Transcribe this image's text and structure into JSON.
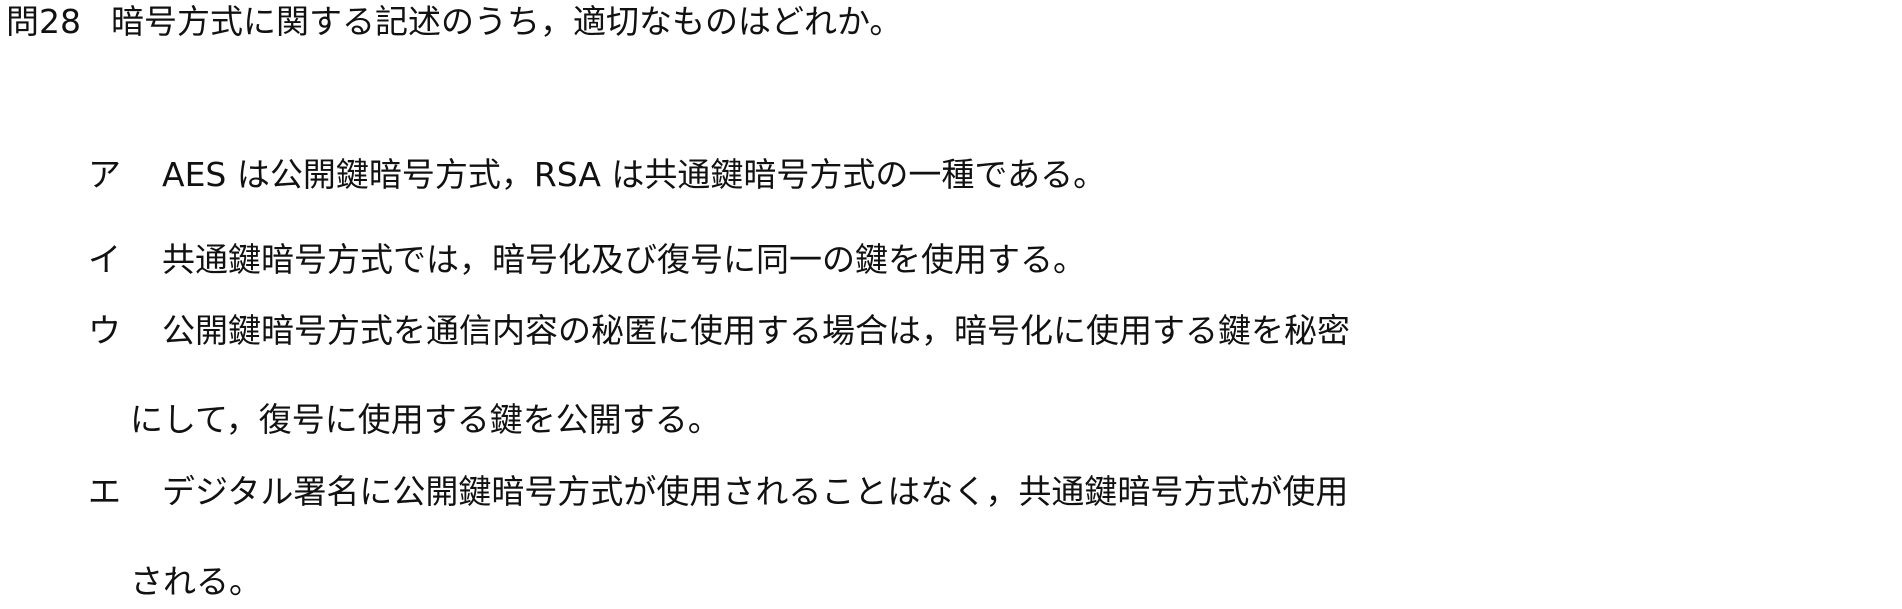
{
  "question": {
    "number": "問28",
    "text": "暗号方式に関する記述のうち，適切なものはどれか。"
  },
  "choices": [
    {
      "label": "ア",
      "lines": [
        "AES は公開鍵暗号方式，RSA は共通鍵暗号方式の一種である。"
      ]
    },
    {
      "label": "イ",
      "lines": [
        "共通鍵暗号方式では，暗号化及び復号に同一の鍵を使用する。"
      ]
    },
    {
      "label": "ウ",
      "lines": [
        "公開鍵暗号方式を通信内容の秘匿に使用する場合は，暗号化に使用する鍵を秘密",
        "にして，復号に使用する鍵を公開する。"
      ]
    },
    {
      "label": "エ",
      "lines": [
        "デジタル署名に公開鍵暗号方式が使用されることはなく，共通鍵暗号方式が使用",
        "される。"
      ]
    }
  ]
}
